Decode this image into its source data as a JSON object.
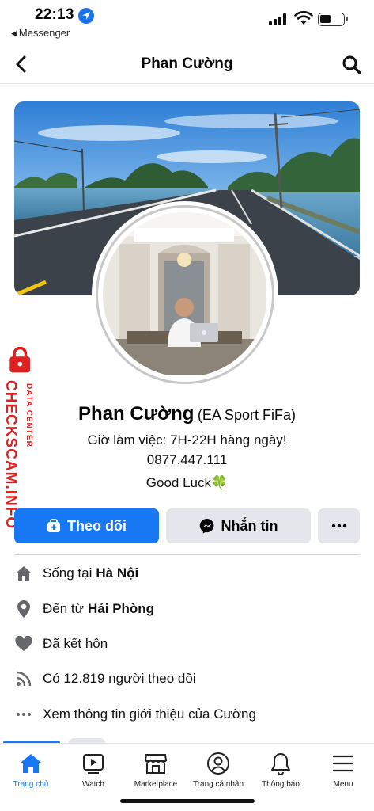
{
  "status_bar": {
    "time": "22:13",
    "back_app": "Messenger"
  },
  "header": {
    "title": "Phan Cường",
    "back_icon": "chevron-left-icon",
    "search_icon": "search-icon"
  },
  "watermark": {
    "brand": "CHECKSCAM.INFO",
    "sub": "DATA CENTER"
  },
  "profile": {
    "name": "Phan Cường",
    "alternate_name": "(EA Sport FiFa)",
    "bio": [
      "Giờ làm việc: 7H-22H hàng ngày!",
      "0877.447.111",
      "Good Luck🍀"
    ]
  },
  "actions": {
    "follow_label": "Theo dõi",
    "message_label": "Nhắn tin",
    "more_icon": "more-dots-icon"
  },
  "info": [
    {
      "icon": "home-icon",
      "prefix": "Sống tại",
      "value": "Hà Nội"
    },
    {
      "icon": "location-pin-icon",
      "prefix": "Đến từ",
      "value": "Hải Phòng"
    },
    {
      "icon": "heart-icon",
      "prefix": "Đã kết hôn",
      "value": ""
    },
    {
      "icon": "rss-icon",
      "prefix": "Có 12.819 người theo dõi",
      "value": ""
    },
    {
      "icon": "more-dots-icon",
      "prefix": "Xem thông tin giới thiệu của Cường",
      "value": ""
    }
  ],
  "bottom_nav": [
    {
      "label": "Trang chủ",
      "icon": "home-icon",
      "active": true
    },
    {
      "label": "Watch",
      "icon": "video-icon",
      "active": false
    },
    {
      "label": "Marketplace",
      "icon": "store-icon",
      "active": false
    },
    {
      "label": "Trang cá nhân",
      "icon": "profile-icon",
      "active": false
    },
    {
      "label": "Thông báo",
      "icon": "bell-icon",
      "active": false
    },
    {
      "label": "Menu",
      "icon": "menu-icon",
      "active": false
    }
  ],
  "colors": {
    "accent": "#1877f2",
    "button_gray": "#e4e6eb",
    "watermark_red": "#e02020"
  }
}
